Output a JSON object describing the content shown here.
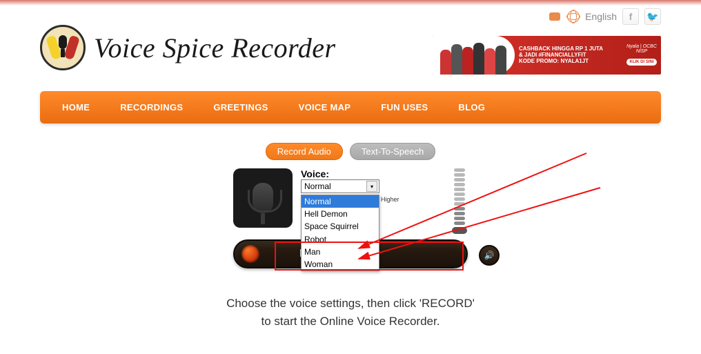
{
  "topbar": {
    "language": "English"
  },
  "site_title": "Voice Spice Recorder",
  "ad": {
    "line1": "CASHBACK HINGGA RP 1 JUTA",
    "line2": "& JADI #FINANCIALLYFIT",
    "line3": "KODE PROMO: NYALA1JT",
    "brand": "Nyala | OCBC NISP",
    "cta": "KLIK DI SINI"
  },
  "nav": {
    "items": [
      "HOME",
      "RECORDINGS",
      "GREETINGS",
      "VOICE MAP",
      "FUN USES",
      "BLOG"
    ]
  },
  "tabs": {
    "record": "Record Audio",
    "tts": "Text-To-Speech"
  },
  "recorder": {
    "voice_label": "Voice:",
    "selected": "Normal",
    "options": [
      "Normal",
      "Hell Demon",
      "Space Squirrel",
      "Robot",
      "Man",
      "Woman"
    ],
    "pitch_higher": "Higher",
    "record_btn": "RECORD"
  },
  "instructions": {
    "line1": "Choose the voice settings, then click 'RECORD'",
    "line2": "to start the Online Voice Recorder."
  }
}
